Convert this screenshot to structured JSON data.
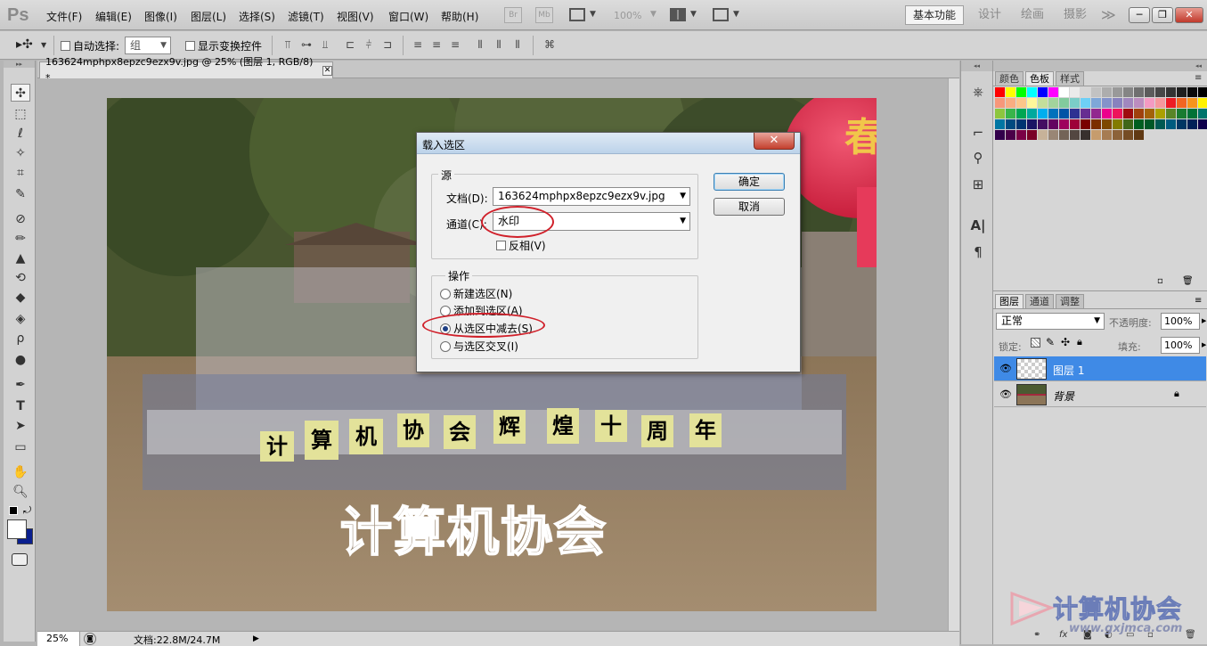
{
  "app": {
    "logo": "Ps"
  },
  "menu": [
    "文件(F)",
    "编辑(E)",
    "图像(I)",
    "图层(L)",
    "选择(S)",
    "滤镜(T)",
    "视图(V)",
    "窗口(W)",
    "帮助(H)"
  ],
  "menubar_tools": {
    "br": "Br",
    "mb": "Mb",
    "zoom": "100%"
  },
  "workspaces": {
    "active": "基本功能",
    "items": [
      "设计",
      "绘画",
      "摄影"
    ],
    "more": "≫"
  },
  "window_controls": {
    "minimize": "─",
    "restore": "❐",
    "close": "✕"
  },
  "options": {
    "auto_select_label": "自动选择:",
    "auto_select_value": "组",
    "show_transform_label": "显示变换控件"
  },
  "document": {
    "tab_title": "163624mphpx8epzc9ezx9v.jpg @ 25% (图层 1, RGB/8) *",
    "tab_close": "✕",
    "zoom": "25%",
    "doc_size": "文档:22.8M/24.7M"
  },
  "canvas": {
    "sign_chars": [
      "计",
      "算",
      "机",
      "协",
      "会",
      "辉",
      "煌",
      "十",
      "周",
      "年"
    ],
    "watermark_text": "计算机协会",
    "banner_char": "春"
  },
  "swatches_panel": {
    "tabs": [
      "颜色",
      "色板",
      "样式"
    ],
    "active_tab": "色板",
    "colors": [
      "#ff0000",
      "#ffff00",
      "#00ff00",
      "#00ffff",
      "#0000ff",
      "#ff00ff",
      "#ffffff",
      "#ebebeb",
      "#d6d6d6",
      "#c2c2c2",
      "#adadad",
      "#999999",
      "#858585",
      "#707070",
      "#5c5c5c",
      "#474747",
      "#333333",
      "#1f1f1f",
      "#0a0a0a",
      "#000000",
      "#f7977a",
      "#f9ad81",
      "#fdc68a",
      "#fff79a",
      "#c4df9b",
      "#a3d39c",
      "#82ca9d",
      "#7bcdc8",
      "#6ecff6",
      "#7ea7d8",
      "#8493ca",
      "#8882be",
      "#a187be",
      "#bc8dbf",
      "#f49ac2",
      "#f6989d",
      "#ed1c24",
      "#f26522",
      "#f7941d",
      "#fff200",
      "#8dc63f",
      "#39b54a",
      "#00a651",
      "#00a99d",
      "#00aeef",
      "#0072bc",
      "#0054a6",
      "#2e3192",
      "#662d91",
      "#92278f",
      "#ec008c",
      "#ed145b",
      "#9e0b0f",
      "#a0410d",
      "#a3620a",
      "#aba000",
      "#598527",
      "#197b30",
      "#007236",
      "#00746b",
      "#0076a3",
      "#004a80",
      "#003471",
      "#1b1464",
      "#440e62",
      "#630460",
      "#9e005d",
      "#9e0039",
      "#790000",
      "#7b2e00",
      "#7d4900",
      "#827b00",
      "#406618",
      "#005e20",
      "#005826",
      "#005952",
      "#005b7f",
      "#003663",
      "#002157",
      "#0d004c",
      "#32004b",
      "#4b0049",
      "#7b0046",
      "#7a0026",
      "#c7b299",
      "#998675",
      "#736357",
      "#534741",
      "#37302d",
      "#c69c6d",
      "#a67c52",
      "#8c6239",
      "#754c24",
      "#603913"
    ]
  },
  "layers_panel": {
    "tabs": [
      "图层",
      "通道",
      "调整"
    ],
    "active_tab": "图层",
    "blend_mode": "正常",
    "opacity_label": "不透明度:",
    "opacity_value": "100%",
    "lock_label": "锁定:",
    "fill_label": "填充:",
    "fill_value": "100%",
    "layers": [
      {
        "name": "图层 1",
        "selected": true,
        "locked": false
      },
      {
        "name": "背景",
        "selected": false,
        "locked": true
      }
    ]
  },
  "dialog": {
    "title": "载入选区",
    "source_label": "源",
    "document_label": "文档(D):",
    "document_value": "163624mphpx8epzc9ezx9v.jpg",
    "channel_label": "通道(C):",
    "channel_value": "水印",
    "invert_label": "反相(V)",
    "operation_label": "操作",
    "operations": [
      {
        "label": "新建选区(N)",
        "selected": false
      },
      {
        "label": "添加到选区(A)",
        "selected": false
      },
      {
        "label": "从选区中减去(S)",
        "selected": true
      },
      {
        "label": "与选区交叉(I)",
        "selected": false
      }
    ],
    "ok_label": "确定",
    "cancel_label": "取消",
    "close": "✕"
  },
  "site_watermark": {
    "text": "计算机协会",
    "url": "www.gxjmca.com"
  }
}
